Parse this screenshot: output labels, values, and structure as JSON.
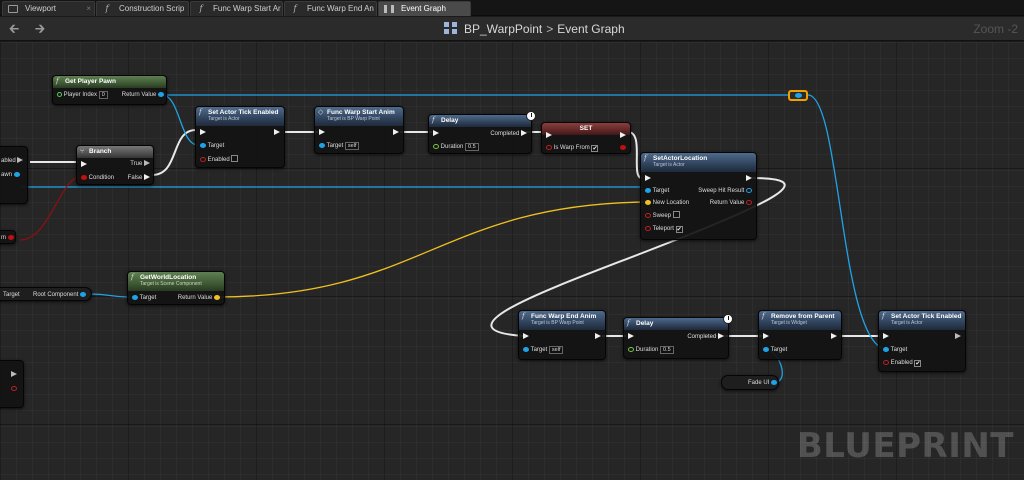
{
  "tabs": [
    {
      "label": "Viewport",
      "icon": "viewport-icon"
    },
    {
      "label": "Construction Scrip",
      "icon": "function-icon"
    },
    {
      "label": "Func Warp Start Ar",
      "icon": "function-icon"
    },
    {
      "label": "Func Warp End An",
      "icon": "function-icon"
    },
    {
      "label": "Event Graph",
      "icon": "event-graph-icon"
    }
  ],
  "header": {
    "blueprint_name": "BP_WarpPoint",
    "separator": ">",
    "graph_name": "Event Graph",
    "zoom": "Zoom -2"
  },
  "watermark": "BLUEPRINT",
  "nodes": {
    "get_player_pawn": {
      "title": "Get Player Pawn",
      "player_index_label": "Player Index",
      "player_index_value": "0",
      "return_value": "Return Value"
    },
    "branch": {
      "title": "Branch",
      "condition": "Condition",
      "true": "True",
      "false": "False"
    },
    "set_actor_tick_enabled_1": {
      "title": "Set Actor Tick Enabled",
      "subtitle": "Target is Actor",
      "target": "Target",
      "enabled": "Enabled"
    },
    "func_warp_start_anim": {
      "title": "Func Warp Start Anim",
      "subtitle": "Target is BP Warp Point",
      "target": "Target",
      "target_value": "self"
    },
    "delay_1": {
      "title": "Delay",
      "completed": "Completed",
      "duration": "Duration",
      "duration_value": "0.5"
    },
    "set": {
      "title": "SET",
      "var": "Is Warp From"
    },
    "set_actor_location": {
      "title": "SetActorLocation",
      "subtitle": "Target is Actor",
      "target": "Target",
      "new_location": "New Location",
      "sweep": "Sweep",
      "teleport": "Teleport",
      "sweep_hit_result": "Sweep Hit Result",
      "return_value": "Return Value"
    },
    "get_world_location": {
      "title": "GetWorldLocation",
      "subtitle": "Target is Scene Component",
      "target": "Target",
      "return_value": "Return Value"
    },
    "root_component": {
      "target": "Target",
      "label": "Root Component"
    },
    "func_warp_end_anim": {
      "title": "Func Warp End Anim",
      "subtitle": "Target is BP Warp Point",
      "target": "Target",
      "target_value": "self"
    },
    "delay_2": {
      "title": "Delay",
      "completed": "Completed",
      "duration": "Duration",
      "duration_value": "0.5"
    },
    "remove_from_parent": {
      "title": "Remove from Parent",
      "subtitle": "Target is Widget",
      "target": "Target"
    },
    "set_actor_tick_enabled_2": {
      "title": "Set Actor Tick Enabled",
      "subtitle": "Target is Actor",
      "target": "Target",
      "enabled": "Enabled"
    },
    "fade_ui": {
      "label": "Fade UI"
    },
    "left_partial": {
      "enabled_frag": "abled",
      "pawn_frag": "awn",
      "var_frag": "m"
    }
  },
  "colors": {
    "exec_wire": "#e8e8e8",
    "object_wire": "#1fa3e8",
    "vector_wire": "#f0c020",
    "bool_wire": "#8c1010"
  }
}
